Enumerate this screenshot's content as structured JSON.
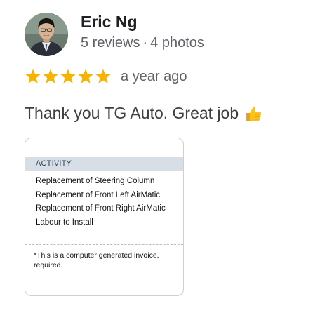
{
  "review": {
    "reviewer_name": "Eric Ng",
    "reviews_count": "5 reviews",
    "separator": "·",
    "photos_count": "4 photos",
    "rating": 5,
    "rating_max": 5,
    "time_ago": "a year ago",
    "text": "Thank you TG Auto. Great job",
    "emoji": "thumbs-up",
    "star_color": "#f4b400"
  },
  "photo": {
    "header": "ACTIVITY",
    "items": [
      "Replacement of Steering Column",
      "Replacement of Front Left AirMatic",
      "Replacement of Front Right AirMatic",
      "Labour to Install"
    ],
    "note_line1": "*This is a computer generated invoice,",
    "note_line2": "required."
  }
}
